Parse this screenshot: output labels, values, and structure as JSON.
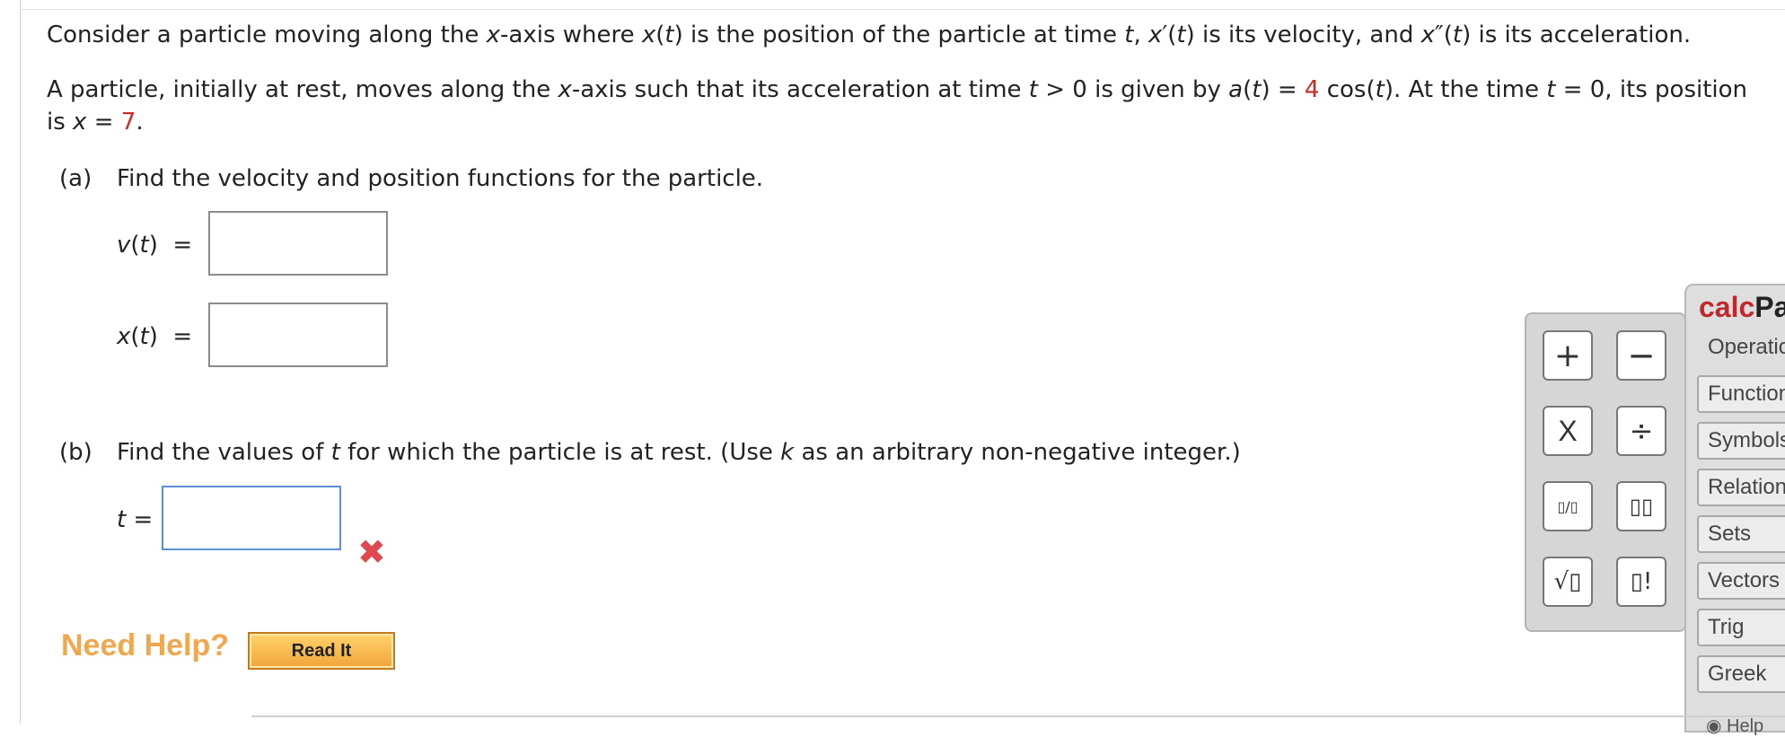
{
  "intro": {
    "p1": [
      "Consider a particle moving along the ",
      "x",
      "-axis where ",
      "x",
      "(",
      "t",
      ") is the position of the particle at time ",
      "t",
      ", ",
      "x",
      "′(",
      "t",
      ") is its velocity, and ",
      "x",
      "″(",
      "t",
      ") is its acceleration."
    ],
    "p2": [
      "A particle, initially at rest, moves along the ",
      "x",
      "-axis such that its acceleration at time ",
      "t",
      " > 0 is given by ",
      "a",
      "(",
      "t",
      ") = ",
      "4",
      " cos(",
      "t",
      "). At the time ",
      "t",
      " = 0, its position"
    ],
    "p3": [
      "is ",
      "x",
      " = ",
      "7",
      "."
    ]
  },
  "part_a": {
    "label": "(a)",
    "question": "Find the velocity and position functions for the particle.",
    "v_label": [
      "v",
      "(",
      "t",
      ")  ="
    ],
    "x_label": [
      "x",
      "(",
      "t",
      ")  ="
    ],
    "v_value": "",
    "x_value": ""
  },
  "part_b": {
    "label": "(b)",
    "question": [
      "Find the values of ",
      "t",
      " for which the particle is at rest. (Use ",
      "k",
      " as an arbitrary non-negative integer.)"
    ],
    "t_label": [
      "t",
      " ="
    ],
    "t_value": "",
    "status_mark": "✖"
  },
  "help": {
    "need_help": "Need Help?",
    "read_it": "Read It"
  },
  "palette": {
    "buttons": [
      "+",
      "—",
      "X",
      "÷",
      "▯/▯",
      "▯▯",
      "√▯",
      "▯!"
    ]
  },
  "calcpad": {
    "title_1": "calc",
    "title_2": "Pad",
    "categories": [
      "Operations",
      "Functions",
      "Symbols",
      "Relations",
      "Sets",
      "Vectors",
      "Trig",
      "Greek"
    ],
    "help": "Help"
  }
}
